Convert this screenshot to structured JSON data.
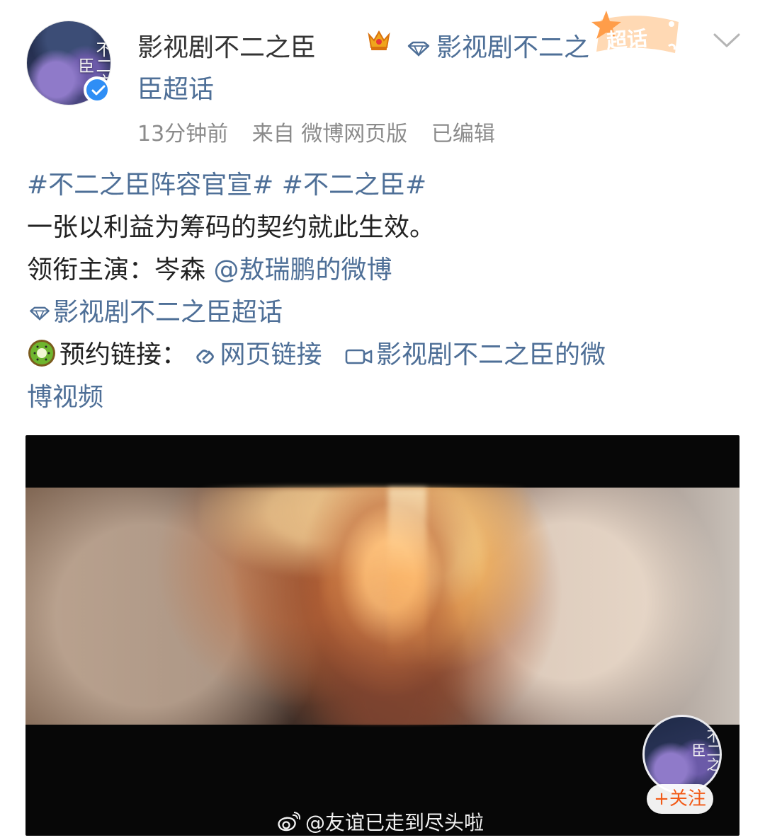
{
  "post": {
    "avatar_title": "不二之臣",
    "username": "影视剧不二之臣",
    "topic_line_1": "影视剧不二之",
    "topic_line_2": "臣超话",
    "supertopic_badge": "超话",
    "meta": {
      "time": "13分钟前",
      "source": "来自 微博网页版",
      "edited": "已编辑"
    }
  },
  "content": {
    "hashtag_1": "#不二之臣阵容官宣#",
    "hashtag_2": "#不二之臣#",
    "line_2": "一张以利益为筹码的契约就此生效。",
    "line_3_label": "领衔主演：岑森 ",
    "line_3_mention": "@敖瑞鹏的微博",
    "line_4_link": "影视剧不二之臣超话",
    "line_5_label": "预约链接：",
    "web_link": "网页链接",
    "video_link_part1": "影视剧不二之臣的微",
    "video_link_part2": "博视频"
  },
  "video": {
    "follow_label": "+关注",
    "watermark": "@友谊已走到尽头啦"
  },
  "icons": {
    "crown": "crown-icon",
    "diamond": "supertopic-diamond-icon",
    "chevron": "chevron-down-icon",
    "kiwi": "kiwi-emoji-icon",
    "link": "link-chain-icon",
    "camera": "video-camera-icon",
    "weibo": "weibo-logo-icon"
  },
  "colors": {
    "link": "#4e6f97",
    "follow": "#f25a17",
    "verify": "#2f8ef5"
  }
}
